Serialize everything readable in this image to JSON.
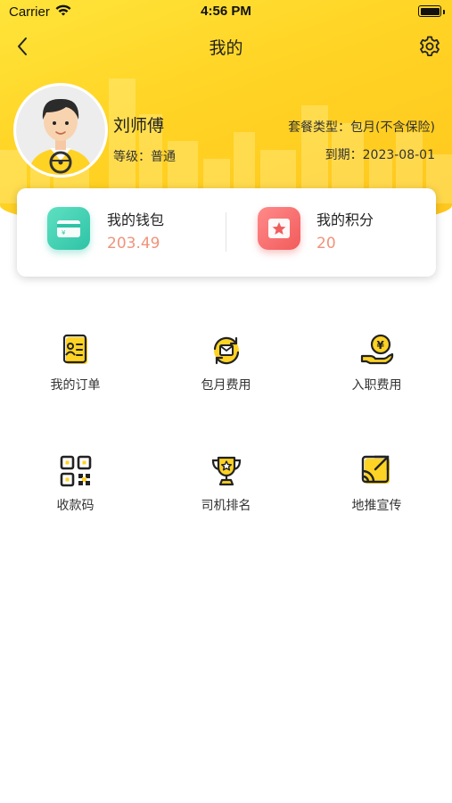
{
  "status_bar": {
    "carrier": "Carrier",
    "time": "4:56 PM"
  },
  "nav": {
    "title": "我的",
    "back_icon": "chevron-left-icon",
    "settings_icon": "gear-icon"
  },
  "profile": {
    "name": "刘师傅",
    "level": "等级：普通",
    "plan": "套餐类型：包月(不含保险)",
    "expire": "到期：2023-08-01"
  },
  "wallet": {
    "wallet_label": "我的钱包",
    "wallet_value": "203.49",
    "points_label": "我的积分",
    "points_value": "20"
  },
  "menu": [
    {
      "label": "我的订单",
      "icon": "order-icon"
    },
    {
      "label": "包月费用",
      "icon": "monthly-fee-icon"
    },
    {
      "label": "入职费用",
      "icon": "onboarding-fee-icon"
    },
    {
      "label": "收款码",
      "icon": "qr-code-icon"
    },
    {
      "label": "司机排名",
      "icon": "trophy-icon"
    },
    {
      "label": "地推宣传",
      "icon": "promotion-icon"
    }
  ],
  "colors": {
    "accent_yellow": "#FFD324",
    "value_orange": "#F0937A",
    "wallet_green": "#2EC3A6",
    "points_red": "#F25B5B"
  }
}
